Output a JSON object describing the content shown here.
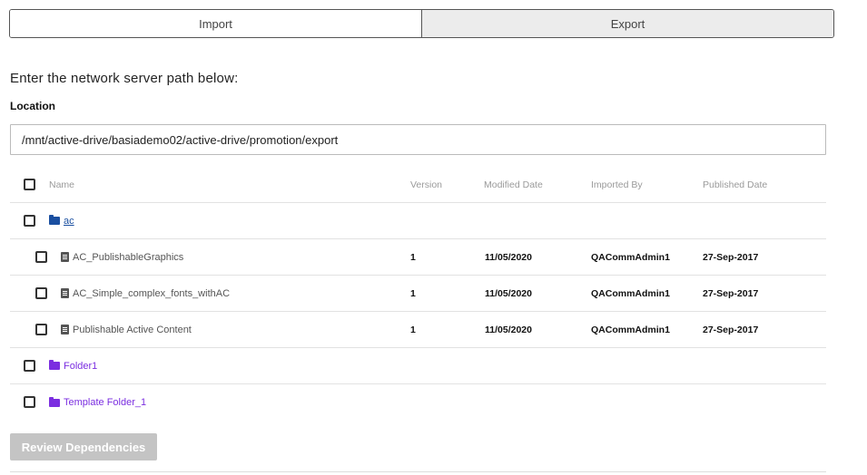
{
  "tabs": {
    "import_label": "Import",
    "export_label": "Export"
  },
  "prompt": "Enter the network server path below:",
  "location": {
    "label": "Location",
    "value": "/mnt/active-drive/basiademo02/active-drive/promotion/export"
  },
  "table": {
    "headers": {
      "name": "Name",
      "version": "Version",
      "modified": "Modified Date",
      "imported_by": "Imported By",
      "published": "Published Date"
    },
    "rows": [
      {
        "type": "folder",
        "color": "#1a4fa0",
        "name": "ac",
        "version": "",
        "modified": "",
        "imported_by": "",
        "published": ""
      },
      {
        "type": "file",
        "name": "AC_PublishableGraphics",
        "version": "1",
        "modified": "11/05/2020",
        "imported_by": "QACommAdmin1",
        "published": "27-Sep-2017"
      },
      {
        "type": "file",
        "name": "AC_Simple_complex_fonts_withAC",
        "version": "1",
        "modified": "11/05/2020",
        "imported_by": "QACommAdmin1",
        "published": "27-Sep-2017"
      },
      {
        "type": "file",
        "name": "Publishable Active Content",
        "version": "1",
        "modified": "11/05/2020",
        "imported_by": "QACommAdmin1",
        "published": "27-Sep-2017"
      },
      {
        "type": "folder",
        "color": "#7b2ee0",
        "name": "Folder1",
        "version": "",
        "modified": "",
        "imported_by": "",
        "published": ""
      },
      {
        "type": "folder",
        "color": "#7b2ee0",
        "name": "Template Folder_1",
        "version": "",
        "modified": "",
        "imported_by": "",
        "published": ""
      }
    ]
  },
  "review_button_label": "Review Dependencies"
}
